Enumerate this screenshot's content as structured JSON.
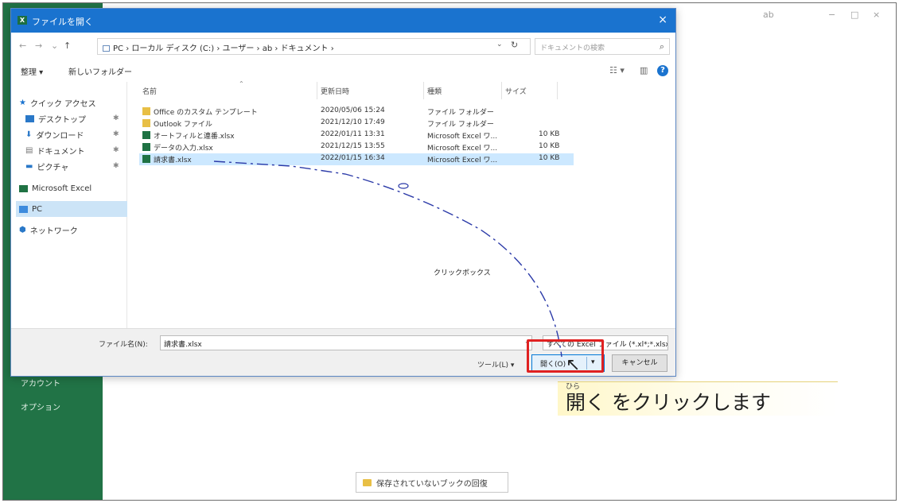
{
  "dialog": {
    "title": "ファイルを開く",
    "close_label": "×",
    "nav": {
      "back": "←",
      "forward": "→",
      "dropdown": "⌄",
      "up": "↑",
      "address": "PC › ローカル ディスク (C:) › ユーザー › ab › ドキュメント ›",
      "refresh": "↻",
      "search_placeholder": "ドキュメントの検索"
    },
    "commands": {
      "organize": "整理 ▾",
      "new_folder": "新しいフォルダー"
    },
    "sidebar": [
      {
        "label": "クイック アクセス",
        "pinned": false
      },
      {
        "label": "デスクトップ",
        "pinned": true
      },
      {
        "label": "ダウンロード",
        "pinned": true
      },
      {
        "label": "ドキュメント",
        "pinned": true
      },
      {
        "label": "ピクチャ",
        "pinned": true
      },
      {
        "label": "Microsoft Excel",
        "pinned": false
      },
      {
        "label": "PC",
        "pinned": false
      },
      {
        "label": "ネットワーク",
        "pinned": false
      }
    ],
    "columns": {
      "name": "名前",
      "date": "更新日時",
      "type": "種類",
      "size": "サイズ"
    },
    "files": [
      {
        "name": "Office のカスタム テンプレート",
        "date": "2020/05/06 15:24",
        "type": "ファイル フォルダー",
        "size": "",
        "kind": "folder"
      },
      {
        "name": "Outlook ファイル",
        "date": "2021/12/10 17:49",
        "type": "ファイル フォルダー",
        "size": "",
        "kind": "folder"
      },
      {
        "name": "オートフィルと連番.xlsx",
        "date": "2022/01/11 13:31",
        "type": "Microsoft Excel ワ...",
        "size": "10 KB",
        "kind": "excel"
      },
      {
        "name": "データの入力.xlsx",
        "date": "2021/12/15 13:55",
        "type": "Microsoft Excel ワ...",
        "size": "10 KB",
        "kind": "excel"
      },
      {
        "name": "請求書.xlsx",
        "date": "2022/01/15 16:34",
        "type": "Microsoft Excel ワ...",
        "size": "10 KB",
        "kind": "excel"
      }
    ],
    "filename_label": "ファイル名(N):",
    "filename_value": "請求書.xlsx",
    "filter_value": "すべての Excel ファイル (*.xl*;*.xlsx ▾",
    "tools_label": "ツール(L) ▾",
    "open_label": "開く(O)",
    "open_arrow": "▾",
    "cancel_label": "キャンセル"
  },
  "excel": {
    "menu_account": "アカウント",
    "menu_options": "オプション",
    "recover_label": "保存されていないブックの回復",
    "window_controls": {
      "user": "ab",
      "minimize": "−",
      "maximize": "□",
      "close": "×"
    }
  },
  "annotation": {
    "click_label": "クリックボックス",
    "callout_ruby": "ひら",
    "callout_text": "開く をクリックします"
  }
}
